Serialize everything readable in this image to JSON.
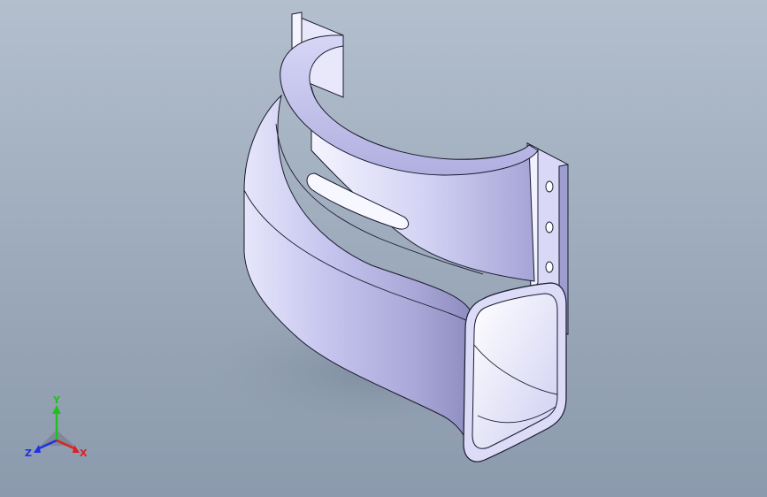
{
  "viewport": {
    "background_top": "#b3bfcd",
    "background_bottom": "#8c9aad"
  },
  "model": {
    "part_color": "#c9c8f0",
    "edge_color": "#1a1a2e"
  },
  "triad": {
    "x_label": "X",
    "y_label": "Y",
    "z_label": "Z",
    "x_color": "#e02020",
    "y_color": "#20c020",
    "z_color": "#2030e0"
  }
}
